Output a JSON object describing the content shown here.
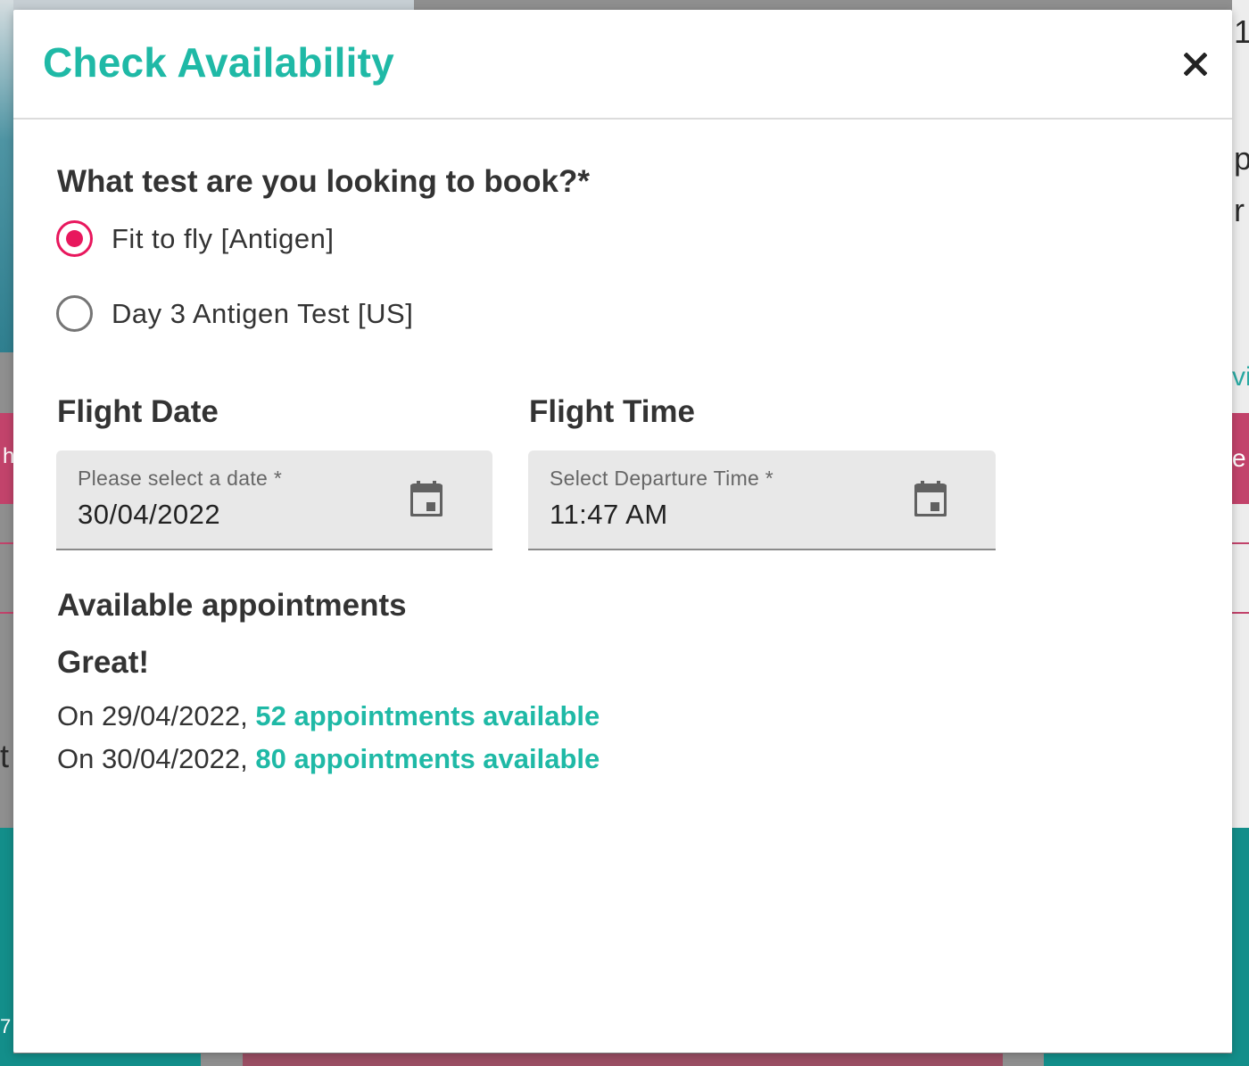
{
  "background": {
    "glyphs": [
      "1",
      "p",
      "r",
      "vi",
      "e",
      "t",
      "h",
      "7"
    ]
  },
  "modal": {
    "title": "Check Availability",
    "close_icon": "close-icon",
    "question": "What test are you looking to book?*",
    "test_options": [
      {
        "label": "Fit to fly [Antigen]",
        "selected": true
      },
      {
        "label": "Day 3 Antigen Test [US]",
        "selected": false
      }
    ],
    "flight_date": {
      "title": "Flight Date",
      "label": "Please select a date *",
      "value": "30/04/2022",
      "icon": "calendar-icon"
    },
    "flight_time": {
      "title": "Flight Time",
      "label": "Select Departure Time *",
      "value": "11:47 AM",
      "icon": "calendar-icon"
    },
    "appointments": {
      "title": "Available appointments",
      "status": "Great!",
      "items": [
        {
          "prefix": "On 29/04/2022,",
          "count_text": "52 appointments available"
        },
        {
          "prefix": "On 30/04/2022,",
          "count_text": "80 appointments available"
        }
      ]
    }
  },
  "colors": {
    "accent_teal": "#1fb9a6",
    "radio_pink": "#e8175d",
    "text_dark": "#333333"
  }
}
